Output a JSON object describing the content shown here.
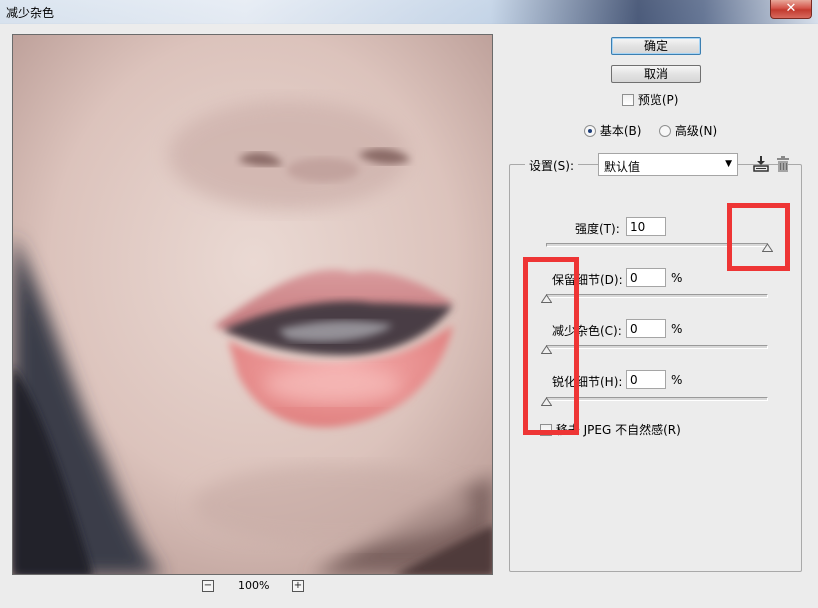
{
  "window": {
    "title": "减少杂色",
    "close_symbol": "✕"
  },
  "buttons": {
    "ok": "确定",
    "cancel": "取消"
  },
  "preview": {
    "label": "预览(P)",
    "checked": false
  },
  "mode": {
    "basic": "基本(B)",
    "advanced": "高级(N)",
    "selected": "basic"
  },
  "settings": {
    "label": "设置(S):",
    "value": "默认值",
    "save_icon": "save-settings-icon",
    "delete_icon": "trash-icon"
  },
  "params": [
    {
      "id": "strength",
      "label": "强度(T):",
      "value": "10",
      "unit": "",
      "level": 1.0
    },
    {
      "id": "preserve",
      "label": "保留细节(D):",
      "value": "0",
      "unit": "%",
      "level": 0.0
    },
    {
      "id": "reduce",
      "label": "减少杂色(C):",
      "value": "0",
      "unit": "%",
      "level": 0.0
    },
    {
      "id": "sharpen",
      "label": "锐化细节(H):",
      "value": "0",
      "unit": "%",
      "level": 0.0
    }
  ],
  "jpeg": {
    "label": "移去 JPEG 不自然感(R)",
    "checked": false
  },
  "zoom": {
    "level": "100%",
    "minus": "−",
    "plus": "+"
  },
  "colors": {
    "highlight": "#ee3535",
    "default_button_border": "#3c7fb1"
  }
}
